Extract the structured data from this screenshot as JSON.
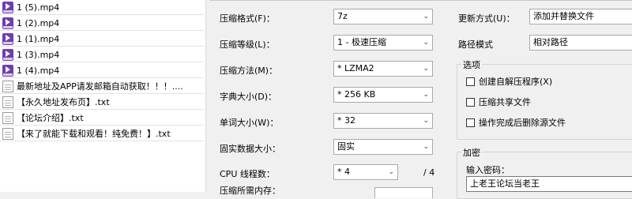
{
  "files": [
    {
      "name": "1 (5).mp4",
      "type": "mp4"
    },
    {
      "name": "1 (2).mp4",
      "type": "mp4"
    },
    {
      "name": "1 (1).mp4",
      "type": "mp4"
    },
    {
      "name": "1 (3).mp4",
      "type": "mp4"
    },
    {
      "name": "1 (4).mp4",
      "type": "mp4"
    },
    {
      "name": "最新地址及APP请发邮箱自动获取！！！....",
      "type": "txt"
    },
    {
      "name": "【永久地址发布页】.txt",
      "type": "txt"
    },
    {
      "name": "【论坛介绍】.txt",
      "type": "txt"
    },
    {
      "name": "【来了就能下载和观看！纯免费！】.txt",
      "type": "txt"
    }
  ],
  "left": {
    "format_label": "压缩格式(F)：",
    "format_value": "7z",
    "level_label": "压缩等级(L)：",
    "level_value": "1 - 极速压缩",
    "method_label": "压缩方法(M)：",
    "method_value": "* LZMA2",
    "dict_label": "字典大小(D)：",
    "dict_value": "* 256 KB",
    "word_label": "单词大小(W)：",
    "word_value": "* 32",
    "solid_label": "固实数据大小：",
    "solid_value": "固实",
    "cpu_label": "CPU 线程数：",
    "cpu_value": "* 4",
    "cpu_total": "/ 4",
    "mem_label": "压缩所需内存："
  },
  "right": {
    "update_label": "更新方式(U)：",
    "update_value": "添加并替换文件",
    "path_label": "路径模式",
    "path_value": "相对路径",
    "options_title": "选项",
    "opt_sfx": "创建自解压程序(X)",
    "opt_shared": "压缩共享文件",
    "opt_delete": "操作完成后删除源文件",
    "encrypt_title": "加密",
    "password_label": "输入密码：",
    "password_value": "上老王论坛当老王"
  }
}
